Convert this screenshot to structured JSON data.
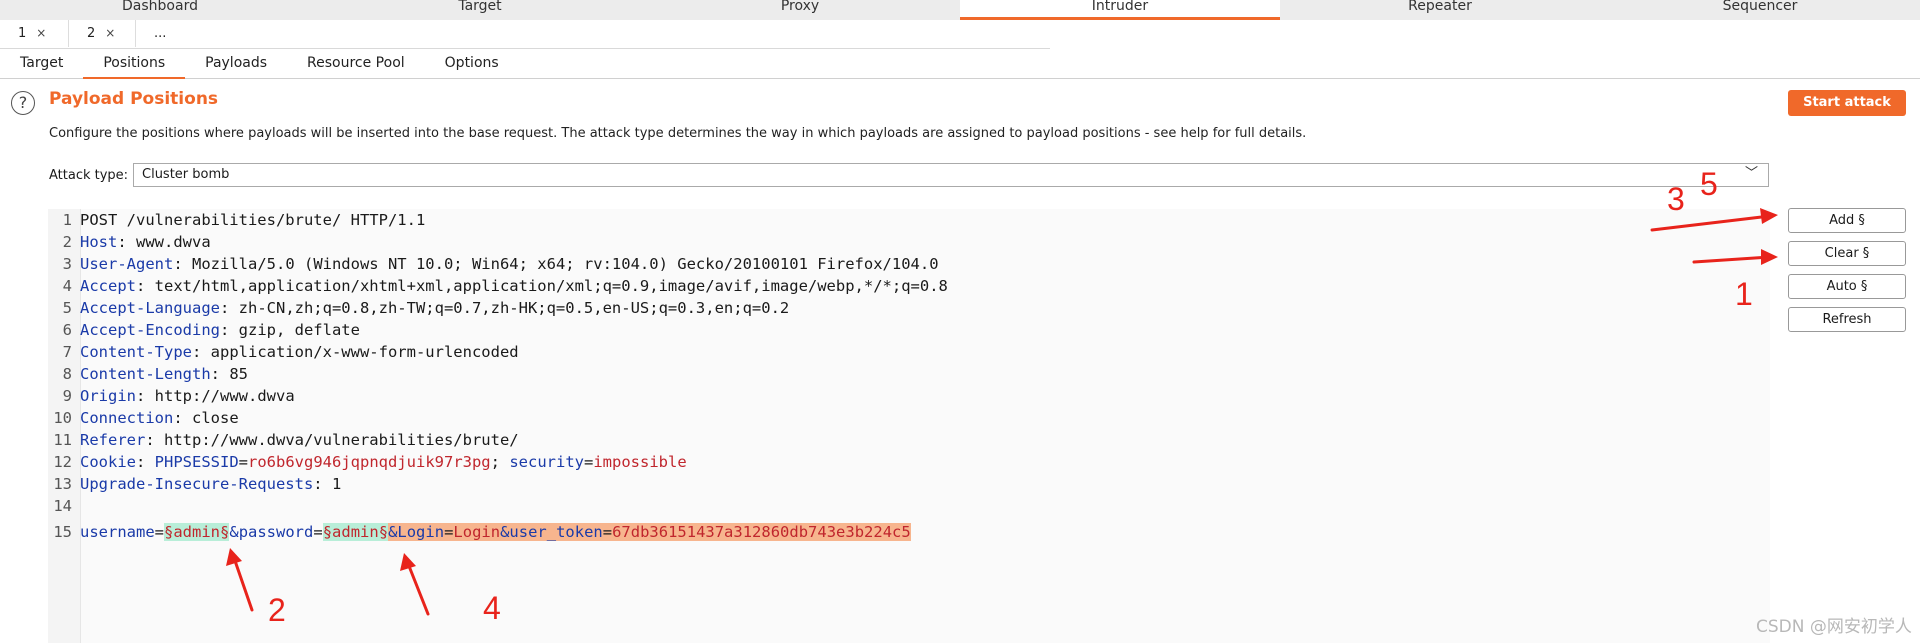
{
  "tool_tabs": [
    {
      "label": "Dashboard",
      "active": false
    },
    {
      "label": "Target",
      "active": false
    },
    {
      "label": "Proxy",
      "active": false
    },
    {
      "label": "Intruder",
      "active": true
    },
    {
      "label": "Repeater",
      "active": false
    },
    {
      "label": "Sequencer",
      "active": false
    }
  ],
  "attack_tabs": [
    {
      "label": "1",
      "close": "×",
      "active": false
    },
    {
      "label": "2",
      "close": "×",
      "active": true
    },
    {
      "label": "...",
      "close": "",
      "active": false
    }
  ],
  "sub_tabs": [
    {
      "label": "Target",
      "active": false
    },
    {
      "label": "Positions",
      "active": true
    },
    {
      "label": "Payloads",
      "active": false
    },
    {
      "label": "Resource Pool",
      "active": false
    },
    {
      "label": "Options",
      "active": false
    }
  ],
  "section": {
    "help_icon": "?",
    "title": "Payload Positions",
    "description": "Configure the positions where payloads will be inserted into the base request. The attack type determines the way in which payloads are assigned to payload positions - see help for full details."
  },
  "start_attack_label": "Start attack",
  "attack_type": {
    "label": "Attack type:",
    "value": "Cluster bomb",
    "chevron": "﹀"
  },
  "side_buttons": {
    "add": "Add §",
    "clear": "Clear §",
    "auto": "Auto §",
    "refresh": "Refresh"
  },
  "request": {
    "line_numbers": [
      "1",
      "2",
      "3",
      "4",
      "5",
      "6",
      "7",
      "8",
      "9",
      "10",
      "11",
      "12",
      "13",
      "14",
      "15"
    ],
    "request_line": "POST /vulnerabilities/brute/ HTTP/1.1",
    "headers": [
      {
        "name": "Host",
        "value": "www.dwva"
      },
      {
        "name": "User-Agent",
        "value": "Mozilla/5.0 (Windows NT 10.0; Win64; x64; rv:104.0) Gecko/20100101 Firefox/104.0"
      },
      {
        "name": "Accept",
        "value": "text/html,application/xhtml+xml,application/xml;q=0.9,image/avif,image/webp,*/*;q=0.8"
      },
      {
        "name": "Accept-Language",
        "value": "zh-CN,zh;q=0.8,zh-TW;q=0.7,zh-HK;q=0.5,en-US;q=0.3,en;q=0.2"
      },
      {
        "name": "Accept-Encoding",
        "value": "gzip, deflate"
      },
      {
        "name": "Content-Type",
        "value": "application/x-www-form-urlencoded"
      },
      {
        "name": "Content-Length",
        "value": "85"
      },
      {
        "name": "Origin",
        "value": "http://www.dwva"
      },
      {
        "name": "Connection",
        "value": "close"
      },
      {
        "name": "Referer",
        "value": "http://www.dwva/vulnerabilities/brute/"
      }
    ],
    "cookie": {
      "name": "Cookie",
      "k1": "PHPSESSID",
      "v1": "ro6b6vg946jqpnqdjuik97r3pg",
      "k2": "security",
      "v2": "impossible"
    },
    "upgrade": {
      "name": "Upgrade-Insecure-Requests",
      "value": "1"
    },
    "body": {
      "k_user": "username",
      "marker": "§",
      "user_value": "admin",
      "amp_pass": "&password",
      "pass_value": "admin",
      "amp_login": "&Login",
      "login_value": "Login",
      "amp_token": "&user_token",
      "token_value": "67db36151437a312860db743e3b224c5"
    }
  },
  "annotations": [
    "1",
    "2",
    "3",
    "4",
    "5"
  ],
  "annotation_color": "#e8231b",
  "accent_color": "#f0692a",
  "watermark": "CSDN @网安初学人"
}
